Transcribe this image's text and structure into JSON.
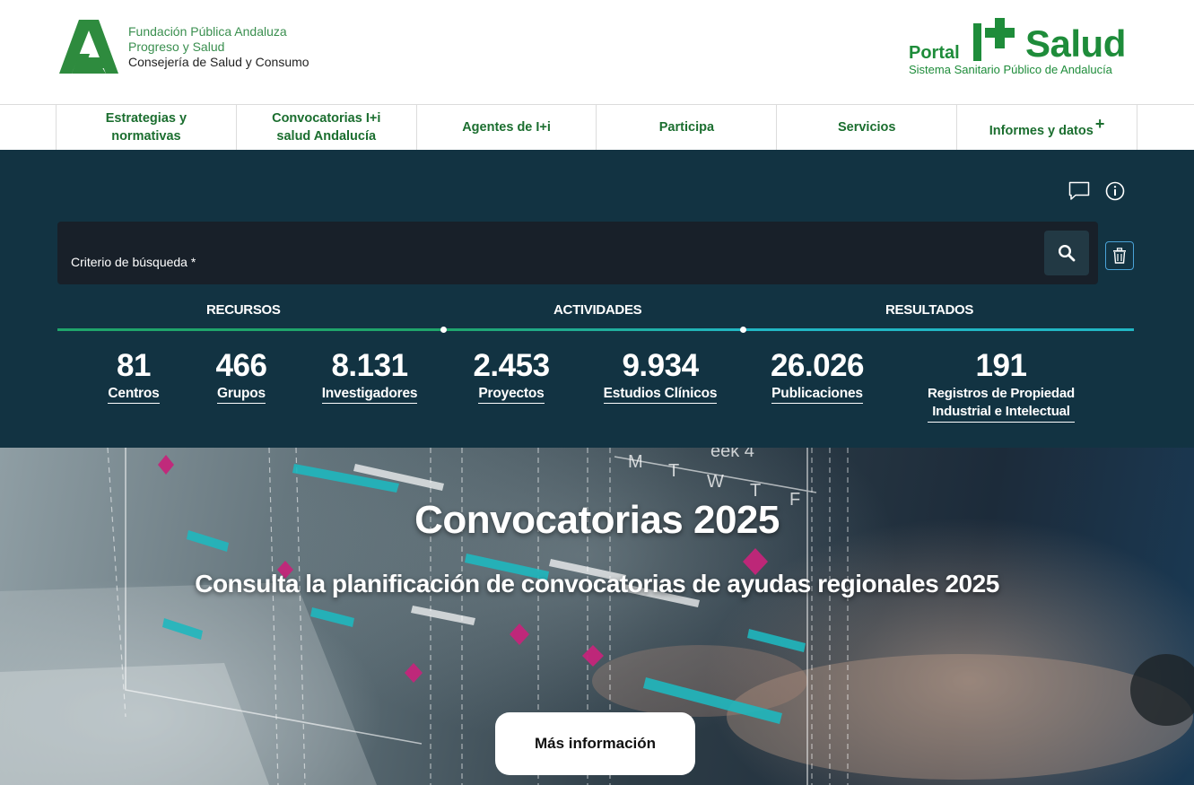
{
  "header": {
    "org_line1": "Fundación Pública Andaluza",
    "org_line2": "Progreso y Salud",
    "org_line3": "Consejería de Salud y Consumo",
    "portal_word": "Portal",
    "portal_name": "Salud",
    "portal_sub": "Sistema Sanitario Público de Andalucía",
    "brand_color": "#1e8c3a"
  },
  "nav": {
    "items": [
      {
        "line1": "Estrategias y",
        "line2": "normativas"
      },
      {
        "line1": "Convocatorias I+i",
        "line2": "salud Andalucía"
      },
      {
        "line1": "Agentes de I+i",
        "line2": ""
      },
      {
        "line1": "Participa",
        "line2": ""
      },
      {
        "line1": "Servicios",
        "line2": ""
      },
      {
        "line1": "Informes y datos",
        "line2": ""
      }
    ],
    "last_plus": "+"
  },
  "panel": {
    "icons": [
      "comment-icon",
      "info-icon"
    ],
    "search_label": "Criterio de búsqueda *",
    "sections": [
      "RECURSOS",
      "ACTIVIDADES",
      "RESULTADOS"
    ],
    "colors": {
      "bg": "#123342",
      "bar_green": "#1fa56b",
      "bar_teal": "#21b7c4"
    },
    "stats": [
      {
        "value": "81",
        "label": "Centros"
      },
      {
        "value": "466",
        "label": "Grupos"
      },
      {
        "value": "8.131",
        "label": "Investigadores"
      },
      {
        "value": "2.453",
        "label": "Proyectos"
      },
      {
        "value": "9.934",
        "label": "Estudios Clínicos"
      },
      {
        "value": "26.026",
        "label": "Publicaciones"
      },
      {
        "value": "191",
        "label1": "Registros de Propiedad",
        "label2": "Industrial e Intelectual"
      }
    ]
  },
  "hero": {
    "title": "Convocatorias 2025",
    "subtitle": "Consulta la planificación de convocatorias de ayudas regionales 2025",
    "button": "Más información",
    "calendar_letters": [
      "M",
      "T",
      "W",
      "T",
      "F"
    ],
    "calendar_header": "eek 4"
  }
}
